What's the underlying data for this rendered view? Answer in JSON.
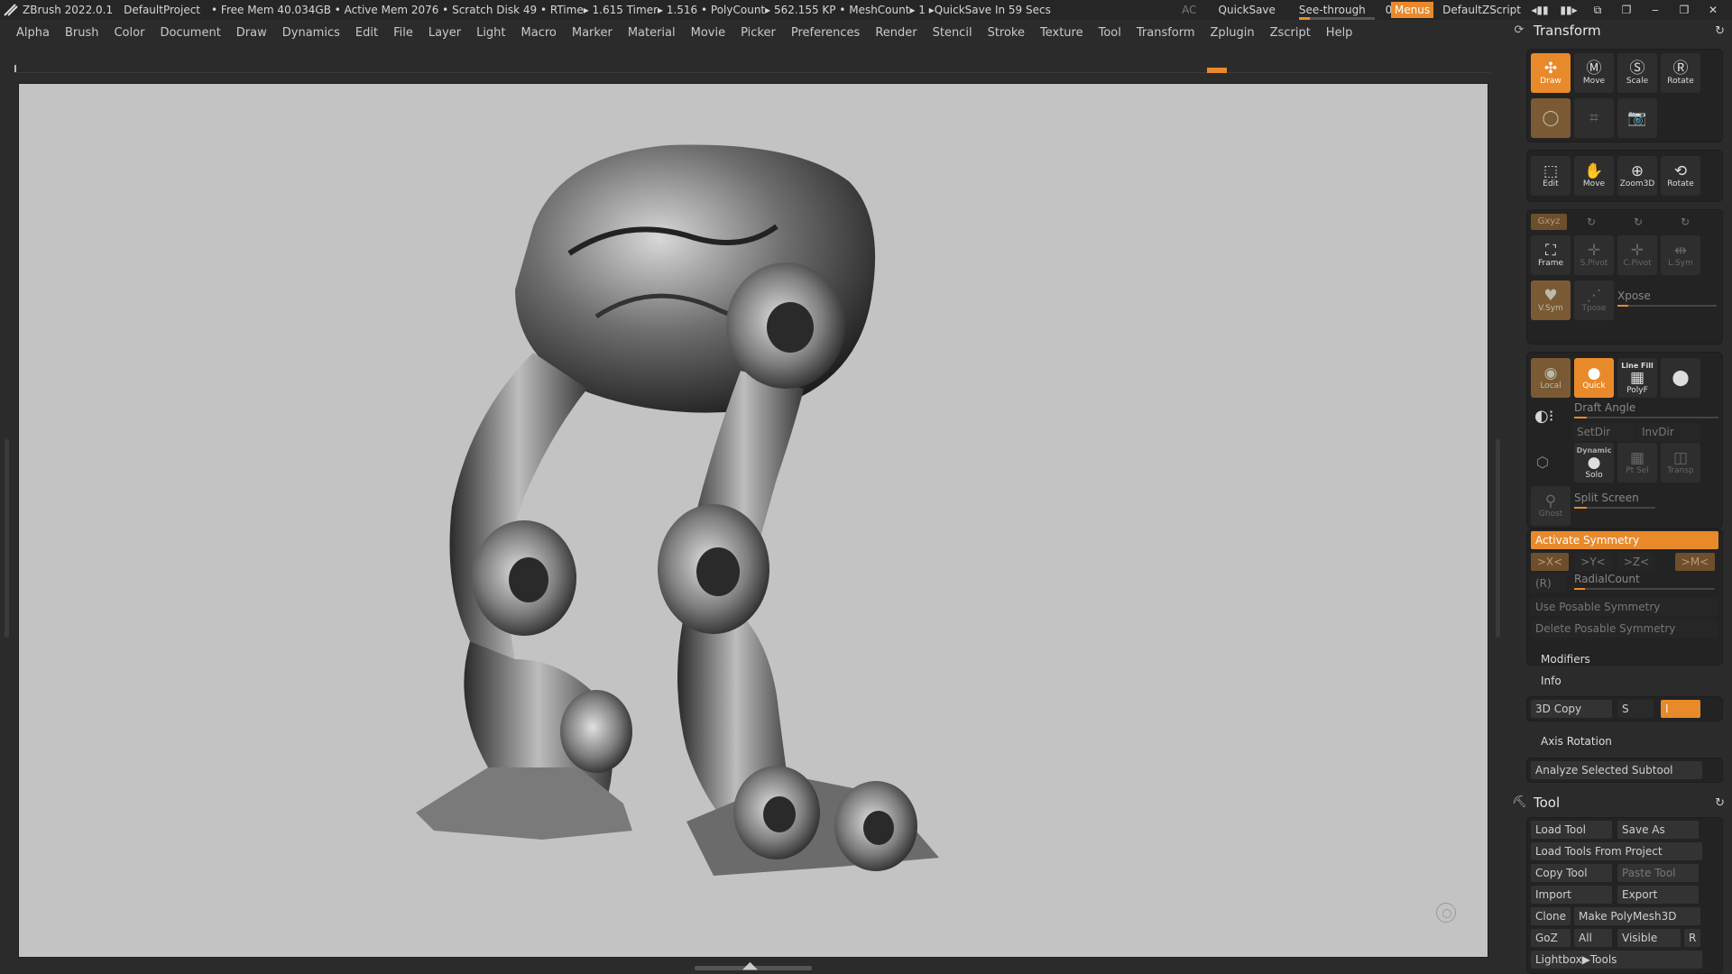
{
  "titlebar": {
    "app": "ZBrush 2022.0.1",
    "project": "DefaultProject",
    "stats": "• Free Mem 40.034GB • Active Mem 2076 • Scratch Disk 49 •  RTime▸ 1.615 Timer▸ 1.516 • PolyCount▸ 562.155 KP  • MeshCount▸ 1  ▸QuickSave In 59 Secs",
    "ac": "AC",
    "quicksave": "QuickSave",
    "seethrough_label": "See-through",
    "seethrough_value": "0",
    "seethrough_level": 0,
    "menus": "Menus",
    "script": "DefaultZScript"
  },
  "menubar": [
    "Alpha",
    "Brush",
    "Color",
    "Document",
    "Draw",
    "Dynamics",
    "Edit",
    "File",
    "Layer",
    "Light",
    "Macro",
    "Marker",
    "Material",
    "Movie",
    "Picker",
    "Preferences",
    "Render",
    "Stencil",
    "Stroke",
    "Texture",
    "Tool",
    "Transform",
    "Zplugin",
    "Zscript",
    "Help"
  ],
  "transform": {
    "title": "Transform",
    "draw": "Draw",
    "move": "Move",
    "scale": "Scale",
    "rotate": "Rotate",
    "edit": "Edit",
    "move2": "Move",
    "zoom3d": "Zoom3D",
    "rotate2": "Rotate",
    "xyz": "Gxyz",
    "frame": "Frame",
    "spivot": "S.Pivot",
    "cpivot": "C.Pivot",
    "lsym": "L.Sym",
    "vsym": "V.Sym",
    "tpose": "Tpose",
    "xpose": "Xpose",
    "local": "Local",
    "quick": "Quick",
    "linefill": "Line Fill",
    "polyf": "PolyF",
    "draft_angle": "Draft Angle",
    "setdir": "SetDir",
    "invdir": "InvDir",
    "dynamic": "Dynamic",
    "solo": "Solo",
    "ptsel": "Pt Sel",
    "transp": "Transp",
    "ghost": "Ghost",
    "split_screen": "Split Screen",
    "activate_symmetry": "Activate Symmetry",
    "sym_x": ">X<",
    "sym_y": ">Y<",
    "sym_z": ">Z<",
    "sym_m": ">M<",
    "r": "(R)",
    "radialcount": "RadialCount",
    "use_posable": "Use Posable Symmetry",
    "delete_posable": "Delete Posable Symmetry",
    "modifiers": "Modifiers",
    "info": "Info",
    "copy3d": "3D Copy",
    "copy_s": "S",
    "copy_i": "I",
    "axis_rotation": "Axis Rotation",
    "analyze": "Analyze Selected Subtool"
  },
  "tool": {
    "title": "Tool",
    "load_tool": "Load Tool",
    "save_as": "Save As",
    "load_from_project": "Load Tools From Project",
    "copy_tool": "Copy Tool",
    "paste_tool": "Paste Tool",
    "import": "Import",
    "export": "Export",
    "clone": "Clone",
    "make_polymesh": "Make PolyMesh3D",
    "goz": "GoZ",
    "all": "All",
    "visible": "Visible",
    "r": "R",
    "lightbox": "Lightbox▶Tools"
  },
  "colors": {
    "accent": "#e88a2a",
    "canvas": "#c3c3c3",
    "ui_bg": "#2b2b2b"
  },
  "icons": [
    "zbrush-logo-icon",
    "reset-icon",
    "tool-icon",
    "nav-gizmo-icon"
  ]
}
